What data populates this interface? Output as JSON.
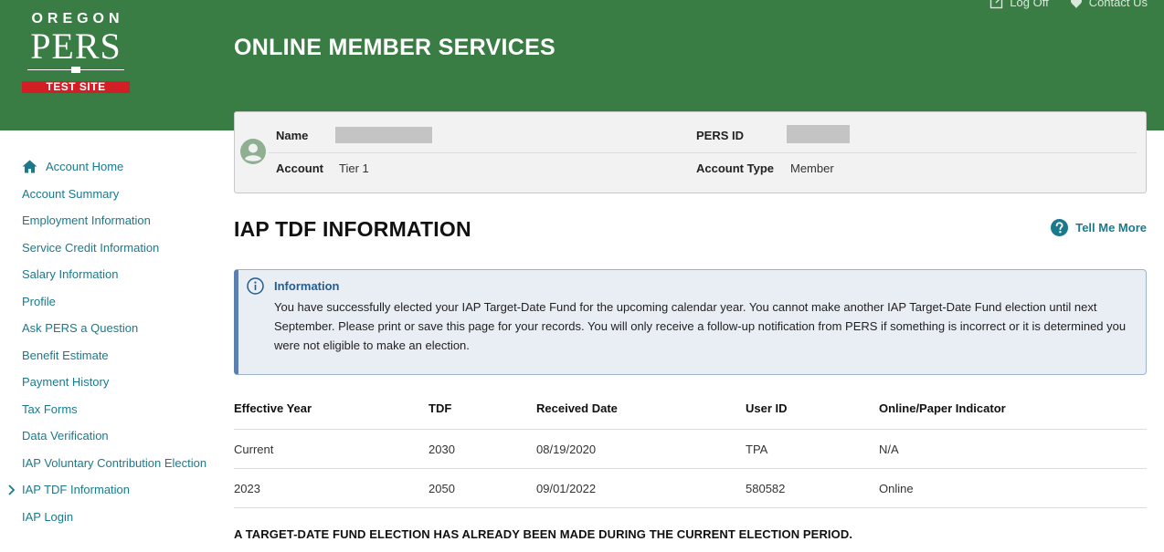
{
  "logo": {
    "line1": "OREGON",
    "line2": "PERS",
    "badge": "TEST SITE"
  },
  "header": {
    "title": "ONLINE MEMBER SERVICES",
    "log_off": "Log Off",
    "contact_us": "Contact Us"
  },
  "sidebar": {
    "items": [
      {
        "label": "Account Home",
        "icon": "home-icon"
      },
      {
        "label": "Account Summary"
      },
      {
        "label": "Employment Information"
      },
      {
        "label": "Service Credit Information"
      },
      {
        "label": "Salary Information"
      },
      {
        "label": "Profile"
      },
      {
        "label": "Ask PERS a Question"
      },
      {
        "label": "Benefit Estimate"
      },
      {
        "label": "Payment History"
      },
      {
        "label": "Tax Forms"
      },
      {
        "label": "Data Verification"
      },
      {
        "label": "IAP Voluntary Contribution Election"
      },
      {
        "label": "IAP TDF Information",
        "active": true
      },
      {
        "label": "IAP Login"
      }
    ]
  },
  "member": {
    "name_label": "Name",
    "pers_id_label": "PERS ID",
    "account_label": "Account",
    "account_value": "Tier 1",
    "account_type_label": "Account Type",
    "account_type_value": "Member"
  },
  "page": {
    "title": "IAP TDF INFORMATION",
    "tell_me_more": "Tell Me More"
  },
  "info": {
    "heading": "Information",
    "text": "You have successfully elected your IAP Target-Date Fund for the upcoming calendar year. You cannot make another IAP Target-Date Fund election until next September. Please print or save this page for your records. You will only receive a follow-up notification from PERS if something is incorrect or it is determined you were not eligible to make an election."
  },
  "table": {
    "headers": [
      "Effective Year",
      "TDF",
      "Received Date",
      "User ID",
      "Online/Paper Indicator"
    ],
    "rows": [
      [
        "Current",
        "2030",
        "08/19/2020",
        "TPA",
        "N/A"
      ],
      [
        "2023",
        "2050",
        "09/01/2022",
        "580582",
        "Online"
      ]
    ]
  },
  "notice": "A TARGET-DATE FUND ELECTION HAS ALREADY BEEN MADE DURING THE CURRENT ELECTION PERIOD.",
  "colors": {
    "header_green": "#3a7d44",
    "link_teal": "#1a7a8c",
    "test_red": "#d21f26",
    "info_blue": "#5b7fb0"
  }
}
